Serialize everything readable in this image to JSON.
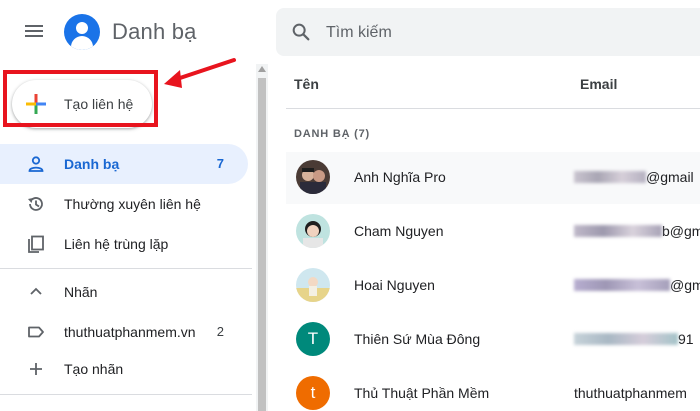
{
  "header": {
    "app_title": "Danh bạ",
    "search_placeholder": "Tìm kiếm"
  },
  "sidebar": {
    "create_label": "Tạo liên hệ",
    "items": [
      {
        "label": "Danh bạ",
        "count": "7",
        "icon": "person-icon",
        "active": true
      },
      {
        "label": "Thường xuyên liên hệ",
        "count": "",
        "icon": "history-icon"
      },
      {
        "label": "Liên hệ trùng lặp",
        "count": "",
        "icon": "copy-icon"
      }
    ],
    "labels_header": "Nhãn",
    "labels": [
      {
        "label": "thuthuatphanmem.vn",
        "count": "2",
        "icon": "label-icon"
      }
    ],
    "create_label_item": "Tạo nhãn"
  },
  "main": {
    "col_name": "Tên",
    "col_email": "Email",
    "section_label": "DANH BẠ (7)",
    "contacts": [
      {
        "name": "Anh Nghĩa Pro",
        "email_visible": "@gmail",
        "avatar": "photo"
      },
      {
        "name": "Cham Nguyen",
        "email_visible": "b@gm",
        "avatar": "photo"
      },
      {
        "name": "Hoai Nguyen",
        "email_visible": "@gm",
        "avatar": "photo"
      },
      {
        "name": "Thiên Sứ Mùa Đông",
        "email_visible": "91",
        "avatar": "letter",
        "letter": "T",
        "color": "#00897b"
      },
      {
        "name": "Thủ Thuật Phần Mềm",
        "email_visible": "thuthuatphanmem",
        "avatar": "letter",
        "letter": "t",
        "color": "#ef6c00"
      }
    ]
  },
  "colors": {
    "accent": "#1a73e8",
    "active_bg": "#e8f0fe",
    "annotation_red": "#e8141e"
  }
}
